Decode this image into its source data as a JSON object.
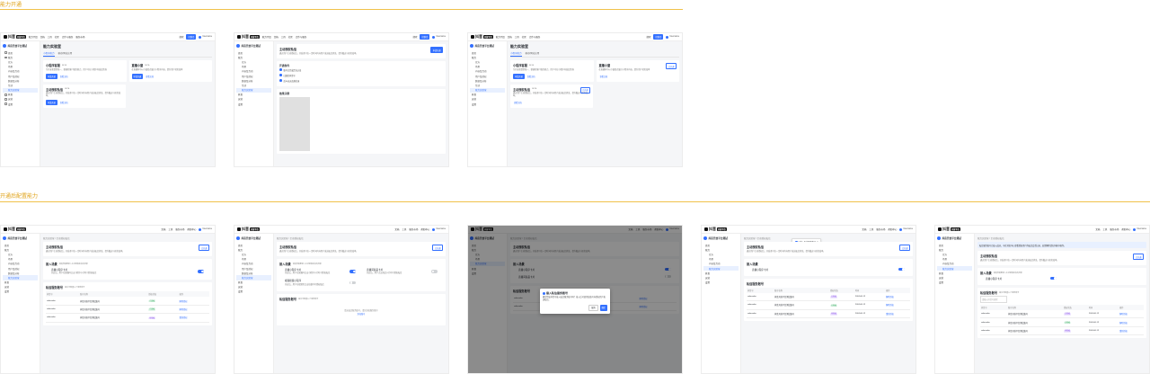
{
  "sections": {
    "open": "能力开通",
    "config": "开通后配置能力"
  },
  "topbar": {
    "logo": "抖音",
    "logo_tag": "开放平台",
    "nav_main": [
      "能力介绍",
      "文档",
      "工具",
      "社区",
      "合作与服务",
      "服务市场",
      "数据开放"
    ],
    "nav_right": [
      "文档",
      "工具",
      "服务市场",
      "帮助中心"
    ],
    "search": "搜索",
    "console": "控制台",
    "user": "Username"
  },
  "sidebar": {
    "app_name": "抖音开放平台测试",
    "items": [
      {
        "label": "首页",
        "sub": false
      },
      {
        "label": "能力",
        "sub": false
      },
      {
        "label": "官方",
        "sub": true
      },
      {
        "label": "场景",
        "sub": true
      },
      {
        "label": "内容及互动",
        "sub": true
      },
      {
        "label": "用户及授权",
        "sub": true
      },
      {
        "label": "数据及分析",
        "sub": true
      },
      {
        "label": "互动",
        "sub": true
      },
      {
        "label": "能力实验室",
        "sub": true,
        "active": true
      },
      {
        "label": "开发",
        "sub": false
      },
      {
        "label": "运营",
        "sub": false
      },
      {
        "label": "设置",
        "sub": false
      }
    ]
  },
  "lab": {
    "title": "能力实验室",
    "tabs": [
      "小程序能力",
      "移动/网站应用"
    ],
    "cards": [
      {
        "title": "小程序客服",
        "badge": "BETA",
        "desc": "为开发者提供统一、便捷的客户服务能力，用户可在小程序内发起咨询",
        "primary": "申请开通",
        "link": "查看文档"
      },
      {
        "title": "直播小窗",
        "badge": "BETA",
        "desc": "在直播间中以小窗形式展示小程序内容，提升用户转化效率",
        "primary": "申请开通",
        "link": "查看文档"
      },
      {
        "title": "主动授权私信",
        "badge": "BETA",
        "desc": "通过用户主动授权后，开发者可在一定时间内向用户发送私信消息，提升触达与转化效率。",
        "primary": "申请开通",
        "link": "查看文档"
      }
    ]
  },
  "detail": {
    "crumb": "能力实验室 / 主动授权私信",
    "title": "主动授权私信",
    "desc": "通过用户主动授权后，开发者可在一定时间内向用户发送私信消息，提升触达与转化效率。",
    "apply": "申请开通",
    "opened": "已开通",
    "conditions_title": "开通条件",
    "conditions": [
      "账号已完成企业认证",
      "已绑定抖音号",
      "近30天无违规记录"
    ],
    "example_title": "效果示例"
  },
  "config": {
    "access_title": "接入场景",
    "access_desc": "请选择需要接入主动授权私信的场景",
    "toggles": [
      {
        "label": "直播小程序卡片",
        "desc": "开启后，用户在直播间点击小程序卡片时可授权私信",
        "on": true
      },
      {
        "label": "直播间商品卡片",
        "desc": "开启后，用户点击商品卡片时可授权私信",
        "on": false
      },
      {
        "label": "视频挂载小程序",
        "desc": "开启后，用户在视频页点击挂载时可授权私信",
        "on": false
      }
    ],
    "accounts_title": "私信服务账号",
    "accounts_desc": "最多可配置10个服务账号",
    "empty": "暂无私信服务账号，请先添加服务账号",
    "add": "添加账号",
    "columns": [
      "抖音号",
      "账号名称",
      "授权状态",
      "时间",
      "操作"
    ],
    "rows": [
      {
        "id": "rakesmba",
        "name": "抖音开放平台测试账号",
        "status": "已授权",
        "time": "2024-06-12",
        "op": "解除授权"
      },
      {
        "id": "rakesmba",
        "name": "抖音开放平台测试账号",
        "status": "已授权",
        "time": "2024-06-12",
        "op": "解除授权"
      },
      {
        "id": "rakesmba",
        "name": "抖音开放平台测试账号",
        "status": "待授权",
        "time": "2024-06-12",
        "op": "重新授权"
      }
    ],
    "search_placeholder": "请输入抖音号搜索",
    "modal": {
      "title": "接入私信服务账号",
      "text": "确定将该抖音号接入私信服务账号吗？接入后可使用该账号向授权用户发送私信。",
      "cancel": "取消",
      "ok": "确定"
    },
    "toast": "已接入私信服务账号",
    "banner": "私信服务账号已接入成功，可在消息中心查看授权用户的私信会话记录，如需解除请在列表中操作。"
  },
  "colors": {
    "accent": "#3370ff",
    "section": "#e0a31a"
  }
}
